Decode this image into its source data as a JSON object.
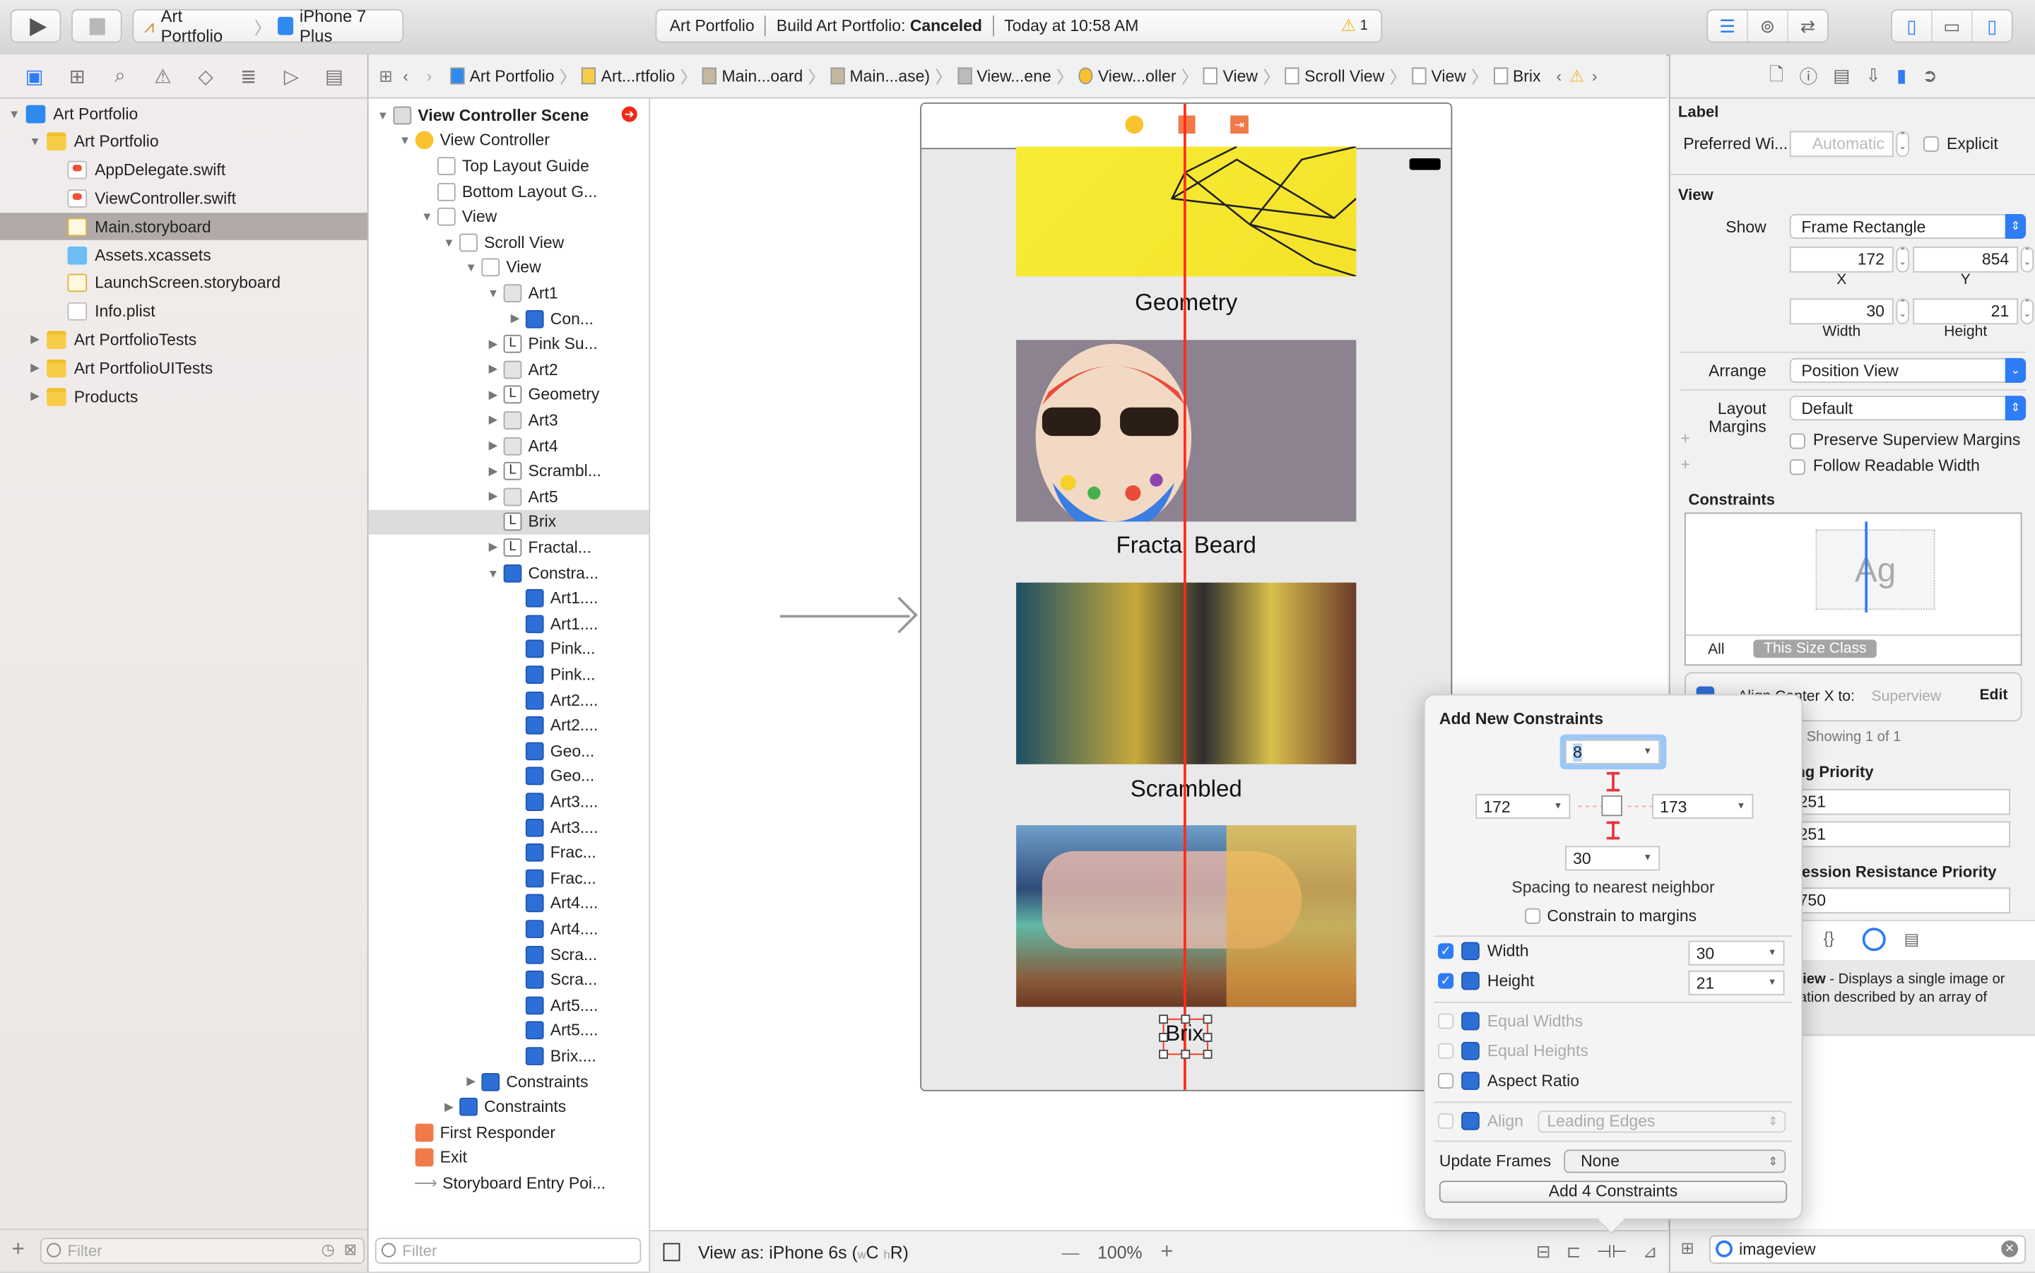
{
  "toolbar": {
    "scheme": "Art Portfolio",
    "device": "iPhone 7 Plus",
    "status_project": "Art Portfolio",
    "status_build_prefix": "Build Art Portfolio:",
    "status_build_result": "Canceled",
    "status_time": "Today at 10:58 AM",
    "warning_count": "1"
  },
  "navigator": {
    "tabs": [
      "project-navigator",
      "symbol-navigator",
      "find-navigator",
      "issue-navigator",
      "test-navigator",
      "debug-navigator",
      "breakpoint-navigator",
      "report-navigator"
    ],
    "tree": [
      {
        "label": "Art Portfolio",
        "kind": "proj",
        "depth": 0,
        "open": true
      },
      {
        "label": "Art Portfolio",
        "kind": "folder",
        "depth": 1,
        "open": true
      },
      {
        "label": "AppDelegate.swift",
        "kind": "swift",
        "depth": 2
      },
      {
        "label": "ViewController.swift",
        "kind": "swift",
        "depth": 2
      },
      {
        "label": "Main.storyboard",
        "kind": "sb",
        "depth": 2,
        "selected": true
      },
      {
        "label": "Assets.xcassets",
        "kind": "assets",
        "depth": 2
      },
      {
        "label": "LaunchScreen.storyboard",
        "kind": "sb",
        "depth": 2
      },
      {
        "label": "Info.plist",
        "kind": "plist",
        "depth": 2
      },
      {
        "label": "Art PortfolioTests",
        "kind": "folder",
        "depth": 1,
        "open": false
      },
      {
        "label": "Art PortfolioUITests",
        "kind": "folder",
        "depth": 1,
        "open": false
      },
      {
        "label": "Products",
        "kind": "folder",
        "depth": 1,
        "open": false
      }
    ],
    "filter_placeholder": "Filter"
  },
  "jumpbar": {
    "crumbs": [
      "Art Portfolio",
      "Art...rtfolio",
      "Main...oard",
      "Main...ase)",
      "View...ene",
      "View...oller",
      "View",
      "Scroll View",
      "View",
      "Brix"
    ]
  },
  "outline": {
    "rows": [
      {
        "label": "View Controller Scene",
        "icon": "scene",
        "depth": 0,
        "tri": "open",
        "bold": true
      },
      {
        "label": "View Controller",
        "icon": "vc",
        "depth": 1,
        "tri": "open"
      },
      {
        "label": "Top Layout Guide",
        "icon": "view",
        "depth": 2,
        "tri": ""
      },
      {
        "label": "Bottom Layout G...",
        "icon": "view",
        "depth": 2,
        "tri": ""
      },
      {
        "label": "View",
        "icon": "view",
        "depth": 2,
        "tri": "open"
      },
      {
        "label": "Scroll View",
        "icon": "view",
        "depth": 3,
        "tri": "open"
      },
      {
        "label": "View",
        "icon": "view",
        "depth": 4,
        "tri": "open"
      },
      {
        "label": "Art1",
        "icon": "img",
        "depth": 5,
        "tri": "open"
      },
      {
        "label": "Con...",
        "icon": "cons",
        "depth": 6,
        "tri": "closed"
      },
      {
        "label": "Pink Su...",
        "icon": "lbl",
        "depth": 5,
        "tri": "closed"
      },
      {
        "label": "Art2",
        "icon": "img",
        "depth": 5,
        "tri": "closed"
      },
      {
        "label": "Geometry",
        "icon": "lbl",
        "depth": 5,
        "tri": "closed"
      },
      {
        "label": "Art3",
        "icon": "img",
        "depth": 5,
        "tri": "closed"
      },
      {
        "label": "Art4",
        "icon": "img",
        "depth": 5,
        "tri": "closed"
      },
      {
        "label": "Scrambl...",
        "icon": "lbl",
        "depth": 5,
        "tri": "closed"
      },
      {
        "label": "Art5",
        "icon": "img",
        "depth": 5,
        "tri": "closed"
      },
      {
        "label": "Brix",
        "icon": "lbl",
        "depth": 5,
        "tri": "",
        "selected": true
      },
      {
        "label": "Fractal...",
        "icon": "lbl",
        "depth": 5,
        "tri": "closed"
      },
      {
        "label": "Constra...",
        "icon": "cons",
        "depth": 5,
        "tri": "open"
      },
      {
        "label": "Art1....",
        "icon": "cons",
        "depth": 6,
        "tri": ""
      },
      {
        "label": "Art1....",
        "icon": "cons",
        "depth": 6,
        "tri": ""
      },
      {
        "label": "Pink...",
        "icon": "cons",
        "depth": 6,
        "tri": ""
      },
      {
        "label": "Pink...",
        "icon": "cons",
        "depth": 6,
        "tri": ""
      },
      {
        "label": "Art2....",
        "icon": "cons",
        "depth": 6,
        "tri": ""
      },
      {
        "label": "Art2....",
        "icon": "cons",
        "depth": 6,
        "tri": ""
      },
      {
        "label": "Geo...",
        "icon": "cons",
        "depth": 6,
        "tri": ""
      },
      {
        "label": "Geo...",
        "icon": "cons",
        "depth": 6,
        "tri": ""
      },
      {
        "label": "Art3....",
        "icon": "cons",
        "depth": 6,
        "tri": ""
      },
      {
        "label": "Art3....",
        "icon": "cons",
        "depth": 6,
        "tri": ""
      },
      {
        "label": "Frac...",
        "icon": "cons",
        "depth": 6,
        "tri": ""
      },
      {
        "label": "Frac...",
        "icon": "cons",
        "depth": 6,
        "tri": ""
      },
      {
        "label": "Art4....",
        "icon": "cons",
        "depth": 6,
        "tri": ""
      },
      {
        "label": "Art4....",
        "icon": "cons",
        "depth": 6,
        "tri": ""
      },
      {
        "label": "Scra...",
        "icon": "cons",
        "depth": 6,
        "tri": ""
      },
      {
        "label": "Scra...",
        "icon": "cons",
        "depth": 6,
        "tri": ""
      },
      {
        "label": "Art5....",
        "icon": "cons",
        "depth": 6,
        "tri": ""
      },
      {
        "label": "Art5....",
        "icon": "cons",
        "depth": 6,
        "tri": ""
      },
      {
        "label": "Brix....",
        "icon": "cons",
        "depth": 6,
        "tri": ""
      },
      {
        "label": "Constraints",
        "icon": "cons",
        "depth": 4,
        "tri": "closed"
      },
      {
        "label": "Constraints",
        "icon": "cons",
        "depth": 3,
        "tri": "closed"
      },
      {
        "label": "First Responder",
        "icon": "fr",
        "depth": 1,
        "tri": ""
      },
      {
        "label": "Exit",
        "icon": "fr",
        "depth": 1,
        "tri": ""
      },
      {
        "label": "Storyboard Entry Poi...",
        "icon": "arrow",
        "depth": 1,
        "tri": ""
      }
    ],
    "filter_placeholder": "Filter"
  },
  "canvas": {
    "captions": [
      "Geometry",
      "Fractal Beard",
      "Scrambled"
    ],
    "selected_label": "Brix",
    "colors": {
      "constraint_line": "#ff2a1a",
      "art1": "#f5e52a",
      "art2": "#8c8290"
    }
  },
  "bottombar": {
    "view_as": "View as: iPhone 6s (",
    "size_w": "w",
    "size_c": "C",
    "size_h": "h",
    "size_r": "R)",
    "zoom": "100%",
    "zoom_out": "—",
    "zoom_in": "+"
  },
  "popover": {
    "title": "Add New Constraints",
    "top": "8",
    "left": "172",
    "right": "173",
    "bottom": "30",
    "spacing_label": "Spacing to nearest neighbor",
    "constrain_margins": "Constrain to margins",
    "width_label": "Width",
    "width_value": "30",
    "width_checked": true,
    "height_label": "Height",
    "height_value": "21",
    "height_checked": true,
    "equal_widths": "Equal Widths",
    "equal_heights": "Equal Heights",
    "aspect_ratio": "Aspect Ratio",
    "align_label": "Align",
    "align_value": "Leading Edges",
    "update_frames_label": "Update Frames",
    "update_frames_value": "None",
    "add_button": "Add 4 Constraints"
  },
  "inspector": {
    "label_section": "Label",
    "preferred_width_label": "Preferred Wi...",
    "preferred_width_placeholder": "Automatic",
    "explicit_label": "Explicit",
    "view_section": "View",
    "show_label": "Show",
    "show_value": "Frame Rectangle",
    "x_value": "172",
    "y_value": "854",
    "x_label": "X",
    "y_label": "Y",
    "width_value": "30",
    "height_value": "21",
    "width_label": "Width",
    "height_label": "Height",
    "arrange_label": "Arrange",
    "arrange_value": "Position View",
    "layout_margins_label": "Layout Margins",
    "layout_margins_value": "Default",
    "preserve_margins": "Preserve Superview Margins",
    "follow_readable": "Follow Readable Width",
    "constraints_section": "Constraints",
    "preview_text": "Ag",
    "scope_all": "All",
    "scope_size_class": "This Size Class",
    "constraint_text": "Align Center X to:",
    "constraint_target": "Superview",
    "constraint_edit": "Edit",
    "showing": "Showing 1 of 1",
    "hugging_title": "Content Hugging Priority",
    "hugging_h": "251",
    "hugging_v": "251",
    "compression_title": "Content Compression Resistance Priority",
    "compression_h": "750",
    "library_desc_bold": "Image View",
    "library_desc": " - Displays a single image or an animation described by an array of images.",
    "library_search": "imageview"
  }
}
